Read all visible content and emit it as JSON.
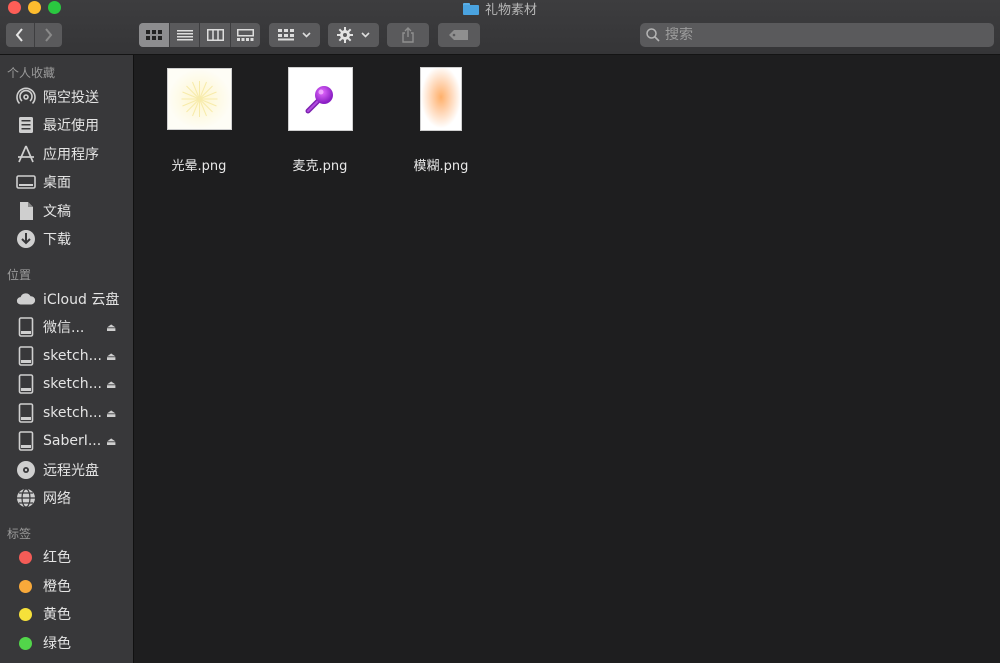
{
  "window": {
    "title": "礼物素材"
  },
  "toolbar": {
    "back_icon": "chevron-left-icon",
    "forward_icon": "chevron-right-icon",
    "view_modes": [
      "icon-view",
      "list-view",
      "column-view",
      "gallery-view"
    ],
    "active_view": "icon-view",
    "search_placeholder": "搜索"
  },
  "sidebar": {
    "favorites_title": "个人收藏",
    "favorites": [
      {
        "label": "隔空投送",
        "icon": "airdrop-icon"
      },
      {
        "label": "最近使用",
        "icon": "recents-icon"
      },
      {
        "label": "应用程序",
        "icon": "applications-icon"
      },
      {
        "label": "桌面",
        "icon": "desktop-icon"
      },
      {
        "label": "文稿",
        "icon": "documents-icon"
      },
      {
        "label": "下载",
        "icon": "downloads-icon"
      }
    ],
    "locations_title": "位置",
    "locations": [
      {
        "label": "iCloud 云盘",
        "icon": "cloud-icon",
        "eject": false
      },
      {
        "label": "微信...",
        "icon": "disk-icon",
        "eject": true
      },
      {
        "label": "sketch...",
        "icon": "disk-icon",
        "eject": true
      },
      {
        "label": "sketch...",
        "icon": "disk-icon",
        "eject": true
      },
      {
        "label": "sketch...",
        "icon": "disk-icon",
        "eject": true
      },
      {
        "label": "SaberI...",
        "icon": "disk-icon",
        "eject": true
      },
      {
        "label": "远程光盘",
        "icon": "optical-disc-icon",
        "eject": false
      },
      {
        "label": "网络",
        "icon": "network-icon",
        "eject": false
      }
    ],
    "tags_title": "标签",
    "tags": [
      {
        "label": "红色",
        "color": "#f45c57"
      },
      {
        "label": "橙色",
        "color": "#f8a93a"
      },
      {
        "label": "黄色",
        "color": "#f6e13a"
      },
      {
        "label": "绿色",
        "color": "#52d64a"
      }
    ]
  },
  "files": [
    {
      "name": "光晕.png",
      "thumbnail": "sunburst-glow"
    },
    {
      "name": "麦克.png",
      "thumbnail": "purple-microphone"
    },
    {
      "name": "模糊.png",
      "thumbnail": "orange-blur"
    }
  ]
}
